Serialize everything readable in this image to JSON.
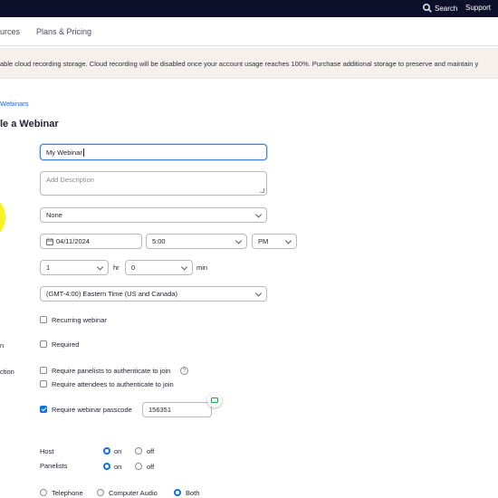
{
  "topbar": {
    "search": "Search",
    "support": "Support"
  },
  "subnav": {
    "resources": "urces",
    "plans": "Plans & Pricing"
  },
  "banner": {
    "text": "able cloud recording storage. Cloud recording will be disabled once your account usage reaches 100%. Purchase additional storage to preserve and maintain y"
  },
  "breadcrumb": "Webinars",
  "page_title": "le a Webinar",
  "form": {
    "topic_value": "My Webinar",
    "description_placeholder": "Add Description",
    "template_value": "None",
    "date_value": "04/11/2024",
    "time_value": "5:00",
    "ampm_value": "PM",
    "duration_hr_value": "1",
    "hr_label": "hr",
    "duration_min_value": "0",
    "min_label": "min",
    "timezone_value": "(GMT-4:00) Eastern Time (US and Canada)",
    "recurring_label": "Recurring webinar",
    "registration_partial_label": "n",
    "required_label": "Required",
    "auth_partial_label": "ction",
    "panelists_auth_label": "Require panelists to authenticate to join",
    "attendees_auth_label": "Require attendees to authenticate to join",
    "passcode_label": "Require webinar passcode",
    "passcode_value": "156351",
    "host_label": "Host",
    "panelists_label": "Panelists",
    "on_label": "on",
    "off_label": "off",
    "audio_telephone": "Telephone",
    "audio_computer": "Computer Audio",
    "audio_both": "Both"
  },
  "colors": {
    "accent": "#0e71eb",
    "topbar": "#0e0f2a",
    "banner": "#f6f0ec"
  }
}
